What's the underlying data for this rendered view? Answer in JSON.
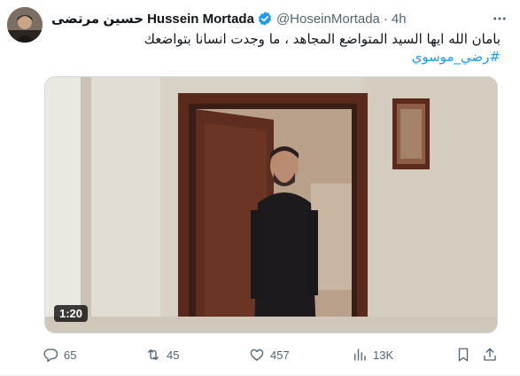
{
  "author": {
    "name_arabic": "حسين مرتضى",
    "name_english": "Hussein Mortada",
    "handle": "@HoseinMortada",
    "separator": "·",
    "time": "4h",
    "verified_color": "#1d9bf0"
  },
  "tweet": {
    "text": "بامان الله ايها السيد المتواضع المجاهد ، ما وجدت انسانا بتواضعك",
    "hashtag": "#رضي_موسوي"
  },
  "media": {
    "type": "video",
    "duration": "1:20"
  },
  "actions": {
    "replies": "65",
    "retweets": "45",
    "likes": "457",
    "views": "13K"
  },
  "icons": {
    "more": "more-icon",
    "reply": "reply-icon",
    "retweet": "retweet-icon",
    "like": "heart-icon",
    "views": "views-icon",
    "bookmark": "bookmark-icon",
    "share": "share-icon"
  },
  "colors": {
    "link": "#1d9bf0",
    "secondary_text": "#536471",
    "primary_text": "#0f1419"
  }
}
